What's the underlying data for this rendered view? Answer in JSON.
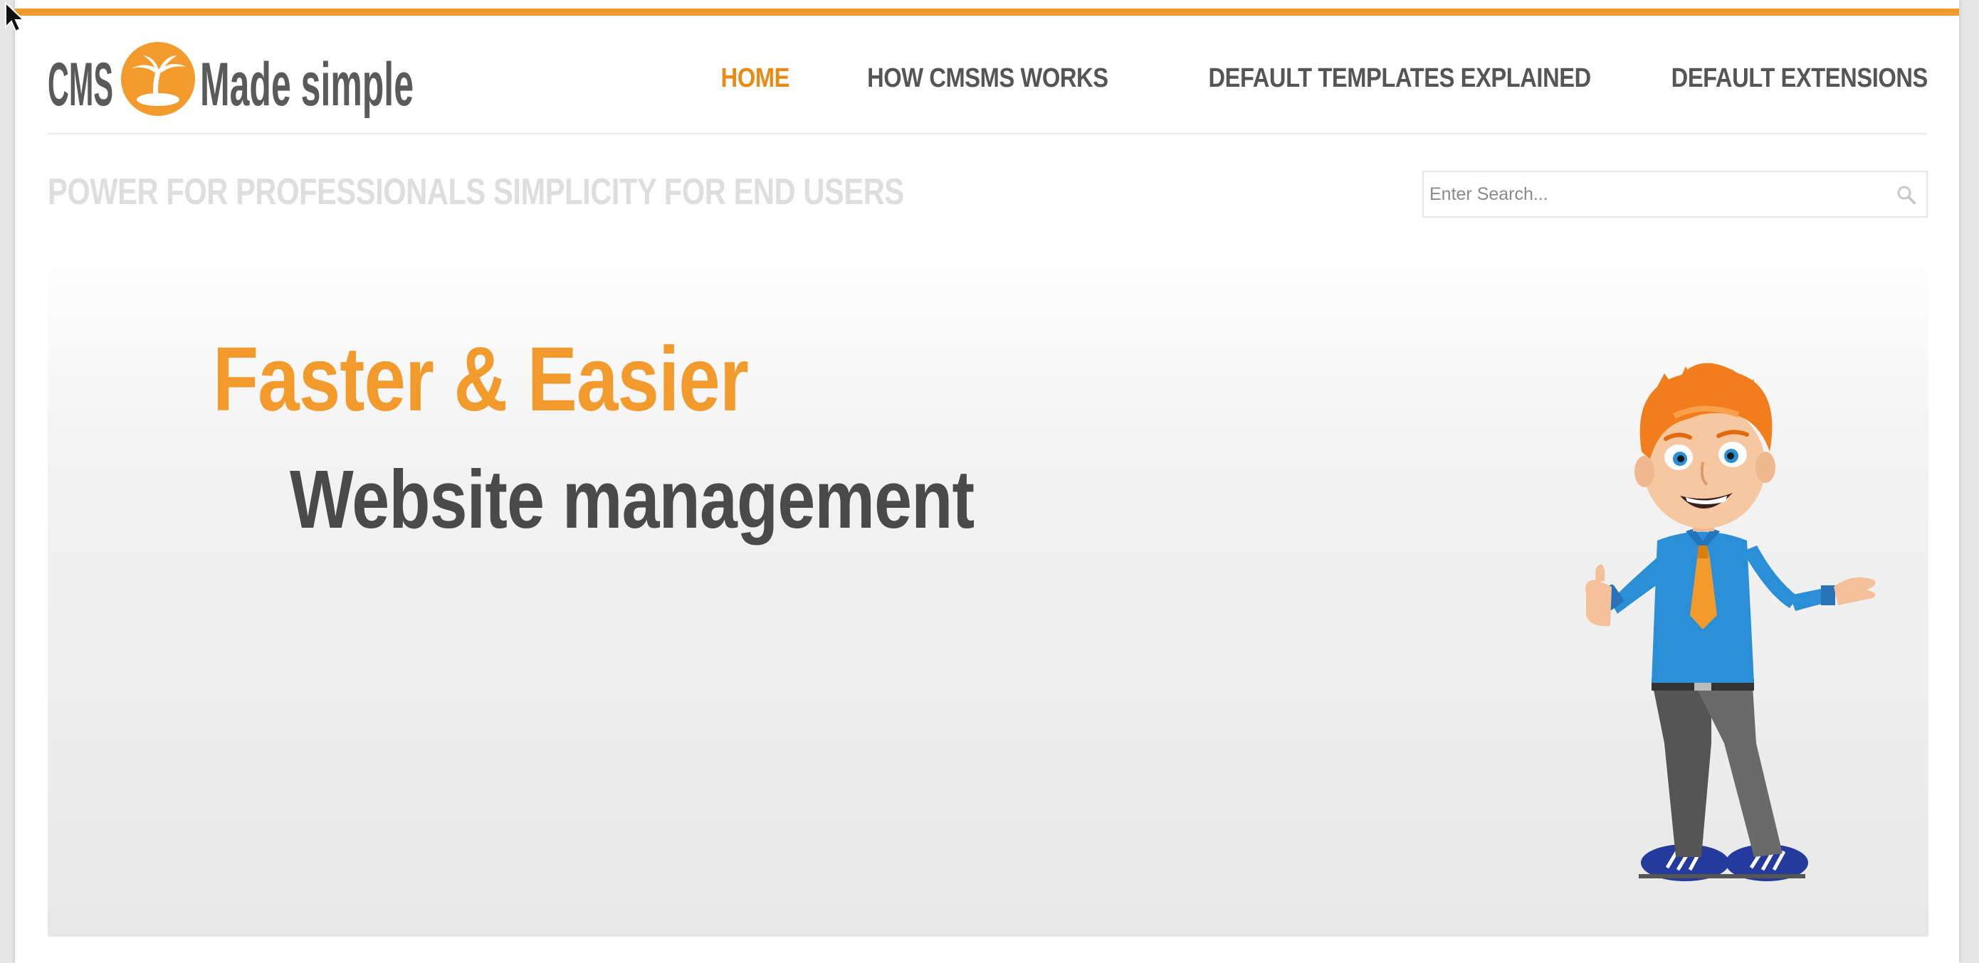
{
  "header": {
    "logo_text_left": "CMS",
    "logo_text_right": "Made simple",
    "nav": [
      {
        "label": "Home",
        "active": true
      },
      {
        "label": "How CMSMS Works",
        "active": false
      },
      {
        "label": "Default Templates Explained",
        "active": false
      },
      {
        "label": "Default Extensions",
        "active": false
      }
    ]
  },
  "tagline": "Power for professionals simplicity for end users",
  "search": {
    "placeholder": "Enter Search..."
  },
  "hero": {
    "title": "Faster & Easier",
    "subtitle": "Website management"
  },
  "colors": {
    "accent": "#f29a2c",
    "nav_text": "#555555",
    "hero_subtitle": "#4a4a4a"
  },
  "icons": [
    "palm-island-logo-icon",
    "search-icon",
    "mascot-illustration",
    "mouse-cursor-icon"
  ]
}
